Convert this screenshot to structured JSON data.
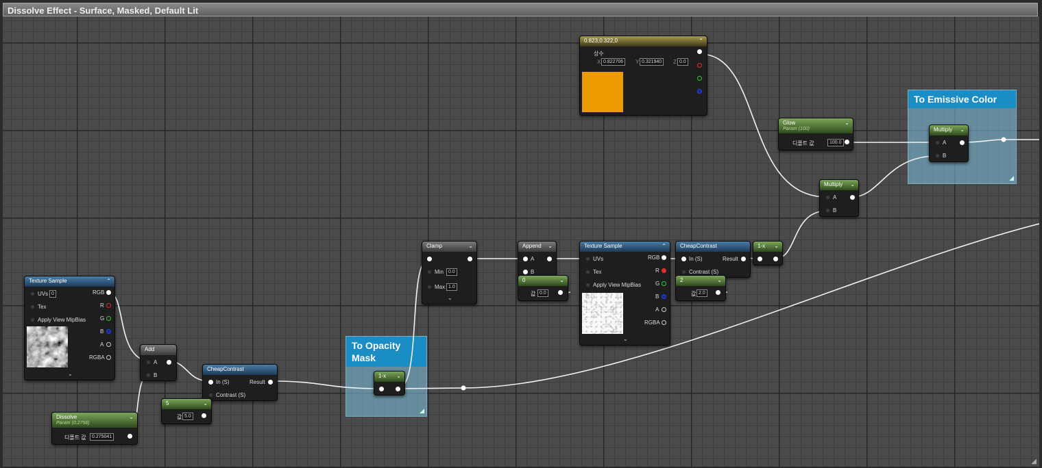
{
  "window": {
    "title": "Dissolve Effect - Surface, Masked, Default Lit"
  },
  "comments": {
    "opacity": "To Opacity Mask",
    "emissive": "To Emissive Color"
  },
  "nodes": {
    "tex1": {
      "title": "Texture Sample",
      "uvs": "UVs",
      "uv_value": "0",
      "tex": "Tex",
      "apply": "Apply View MipBias",
      "rgb": "RGB",
      "r": "R",
      "g": "G",
      "b": "B",
      "a": "A",
      "rgba": "RGBA"
    },
    "add": {
      "title": "Add",
      "a": "A",
      "b": "B"
    },
    "dissolve": {
      "title": "Dissolve",
      "sub": "Param (0.2758)",
      "label": "디폴트 값",
      "value": "0.275041"
    },
    "cc1": {
      "title": "CheapContrast",
      "in": "In (S)",
      "contrast": "Contrast (S)",
      "result": "Result"
    },
    "const5": {
      "title": "5",
      "label": "값",
      "value": "5.0"
    },
    "oneminus1": {
      "title": "1-x"
    },
    "clamp": {
      "title": "Clamp",
      "min": "Min",
      "min_value": "0.0",
      "max": "Max",
      "max_value": "1.0"
    },
    "append": {
      "title": "Append",
      "a": "A",
      "b": "B"
    },
    "const0": {
      "title": "0",
      "label": "값",
      "value": "0.0"
    },
    "tex2": {
      "title": "Texture Sample",
      "uvs": "UVs",
      "tex": "Tex",
      "apply": "Apply View MipBias",
      "rgb": "RGB",
      "r": "R",
      "g": "G",
      "b": "B",
      "a": "A",
      "rgba": "RGBA"
    },
    "cc2": {
      "title": "CheapContrast",
      "in": "In (S)",
      "contrast": "Contrast (S)",
      "result": "Result"
    },
    "const2": {
      "title": "2",
      "label": "값",
      "value": "2.0"
    },
    "oneminus2": {
      "title": "1-x"
    },
    "vec3": {
      "title": "0.823,0.322,0",
      "label": "상수",
      "x": "X",
      "x_value": "0.822706",
      "y": "Y",
      "y_value": "0.321940",
      "z": "Z",
      "z_value": "0.0",
      "swatch": "#ec9b00"
    },
    "glow": {
      "title": "Glow",
      "sub": "Param (100)",
      "label": "디폴트 값",
      "value": "100.0"
    },
    "mult1": {
      "title": "Multiply",
      "a": "A",
      "b": "B"
    },
    "mult2": {
      "title": "Multiply",
      "a": "A",
      "b": "B"
    }
  }
}
